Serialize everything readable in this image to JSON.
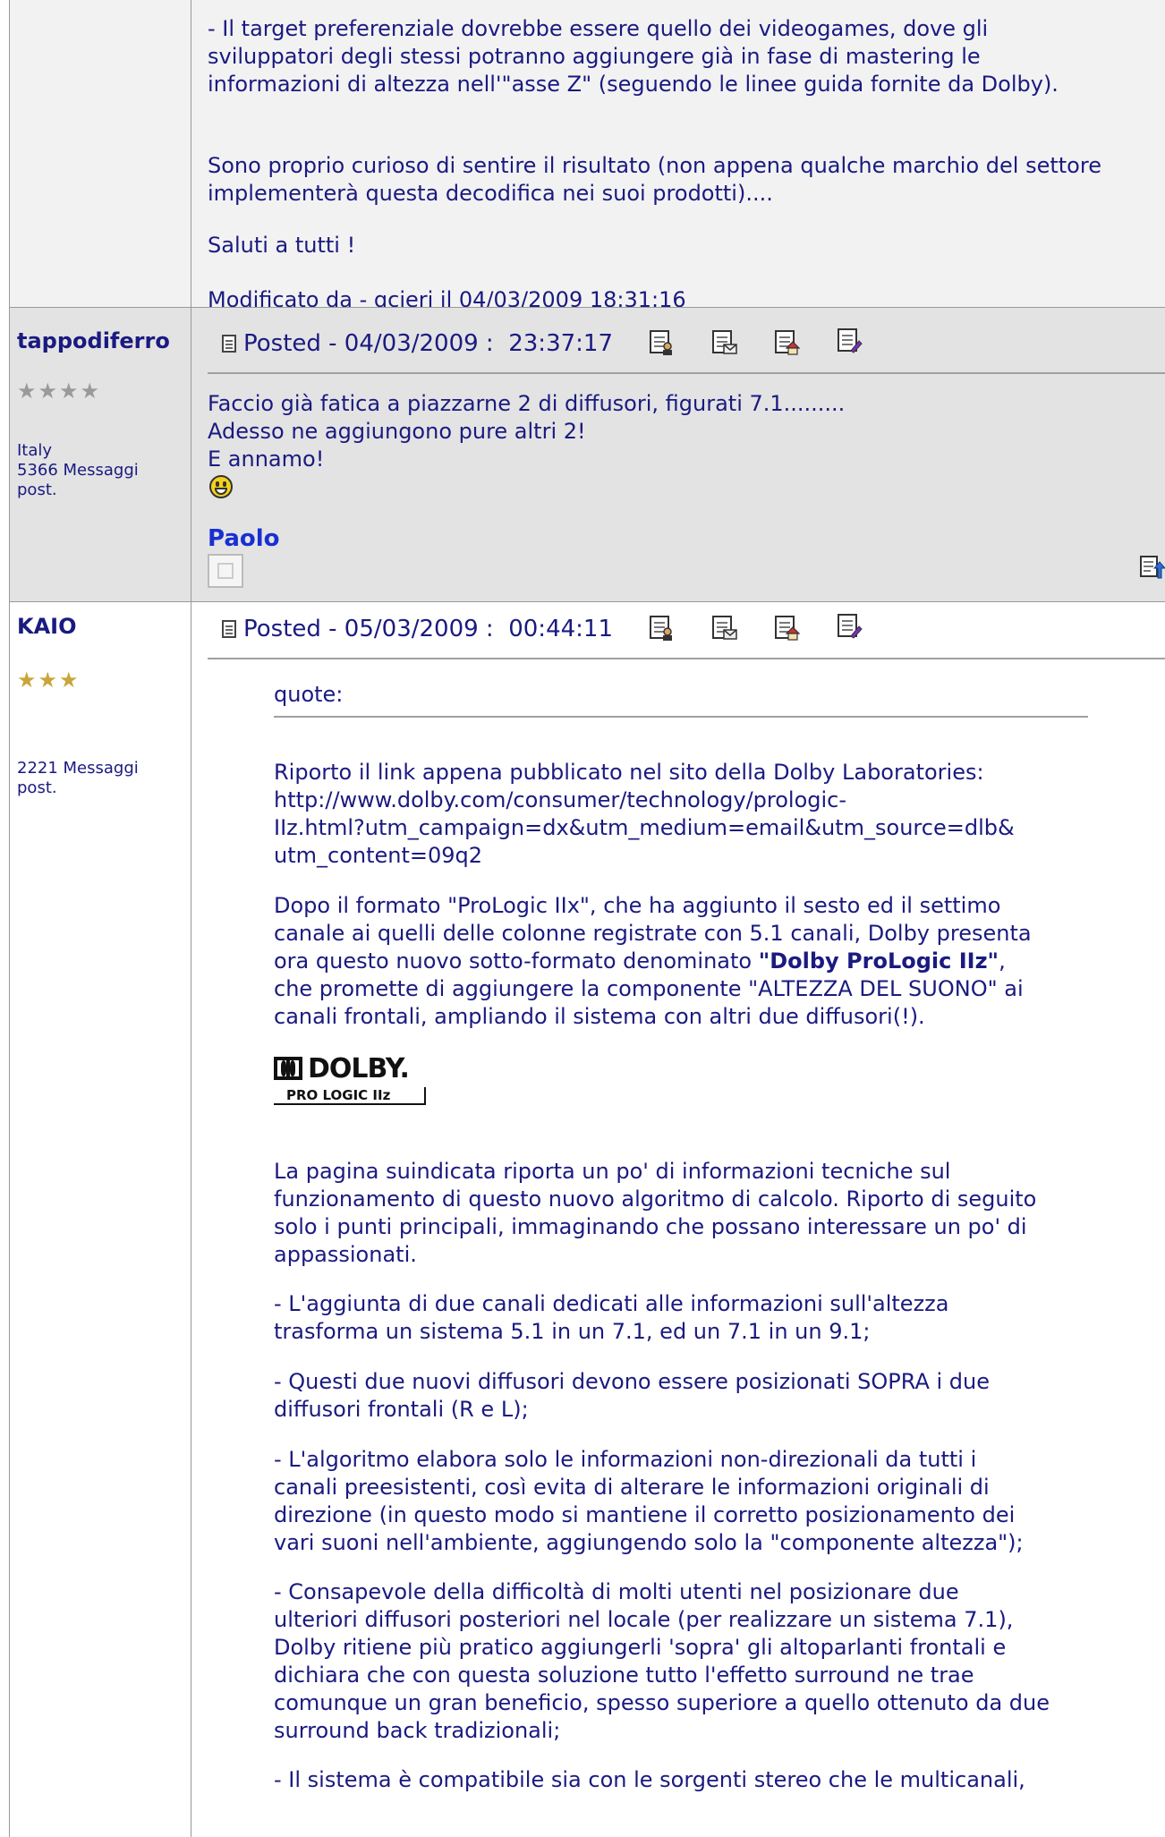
{
  "post1": {
    "lines": [
      "- Il target preferenziale dovrebbe essere quello dei videogames, dove gli",
      "sviluppatori degli stessi potranno aggiungere già in fase di mastering le",
      "informazioni di altezza nell'\"asse Z\" (seguendo le linee guida fornite da Dolby)."
    ],
    "p2_lines": [
      "Sono proprio curioso di sentire il risultato (non appena qualche marchio del settore",
      "implementerà questa decodifica nei suoi prodotti)...."
    ],
    "greeting": "Saluti a tutti !",
    "modified": "Modificato da - qcieri il 04/03/2009 18:31:16"
  },
  "post2": {
    "username": "tappodiferro",
    "stars": "★★★★",
    "location": "Italy",
    "messages": "5366 Messaggi",
    "post_suffix": "post.",
    "posted": "Posted - 04/03/2009 :  23:37:17",
    "lines": [
      "Faccio già fatica a piazzarne 2 di diffusori, figurati 7.1.........",
      "Adesso ne aggiungono pure altri 2!",
      "E annamo!"
    ],
    "signature": "Paolo"
  },
  "post3": {
    "username": "KAIO",
    "stars": "★★★",
    "messages": "2221 Messaggi",
    "post_suffix": "post.",
    "posted": "Posted - 05/03/2009 :  00:44:11",
    "quote_label": "quote:",
    "q1": [
      "Riporto il link appena pubblicato nel sito della Dolby Laboratories:",
      "http://www.dolby.com/consumer/technology/prologic-",
      "IIz.html?utm_campaign=dx&utm_medium=email&utm_source=dlb&",
      "utm_content=09q2"
    ],
    "q2_line1": "Dopo il formato \"ProLogic IIx\", che ha aggiunto il sesto ed il settimo",
    "q2_line2": "canale ai quelli delle colonne registrate con 5.1 canali, Dolby presenta",
    "q2_line3_pre": "ora questo nuovo sotto-formato denominato ",
    "q2_line3_bold": "\"Dolby ProLogic IIz\"",
    "q2_line3_post": ",",
    "q2_line4": "che promette di aggiungere la componente \"ALTEZZA DEL SUONO\" ai",
    "q2_line5": "canali frontali, ampliando il sistema con altri due diffusori(!).",
    "logo_top": "DOLBY.",
    "logo_bottom": "PRO LOGIC IIz",
    "q3": [
      "La pagina suindicata riporta un po' di informazioni tecniche sul",
      "funzionamento di questo nuovo algoritmo di calcolo. Riporto di seguito",
      "solo i punti principali, immaginando che possano interessare un po' di",
      "appassionati."
    ],
    "q4": [
      "- L'aggiunta di due canali dedicati alle informazioni sull'altezza",
      "trasforma un sistema 5.1 in un 7.1, ed un 7.1 in un 9.1;"
    ],
    "q5": [
      "- Questi due nuovi diffusori devono essere posizionati SOPRA i due",
      "diffusori frontali (R e L);"
    ],
    "q6": [
      "- L'algoritmo elabora solo le informazioni non-direzionali da tutti i",
      "canali preesistenti, così evita di alterare le informazioni originali di",
      "direzione (in questo modo si mantiene il corretto posizionamento dei",
      "vari suoni nell'ambiente, aggiungendo solo la \"componente altezza\");"
    ],
    "q7": [
      "- Consapevole della difficoltà di molti utenti nel posizionare due",
      "ulteriori diffusori posteriori nel locale (per realizzare un sistema 7.1),",
      "Dolby ritiene più pratico aggiungerli 'sopra' gli altoparlanti frontali e",
      "dichiara che con questa soluzione tutto l'effetto surround ne trae",
      "comunque un gran beneficio, spesso superiore a quello ottenuto da due",
      "surround back tradizionali;"
    ],
    "q8": [
      "- Il sistema è compatibile sia con le sorgenti stereo che le multicanali,"
    ]
  },
  "icons": [
    "profile-icon",
    "email-icon",
    "homepage-icon",
    "edit-icon",
    "reply-quote-icon"
  ],
  "colors": {
    "text": "#1a1a80",
    "signature": "#1a2fd1",
    "row_alt": "#e3e3e3",
    "row_light": "#f2f2f2",
    "stars_grey": "#9a9a9a",
    "stars_gold": "#c9a63b"
  }
}
